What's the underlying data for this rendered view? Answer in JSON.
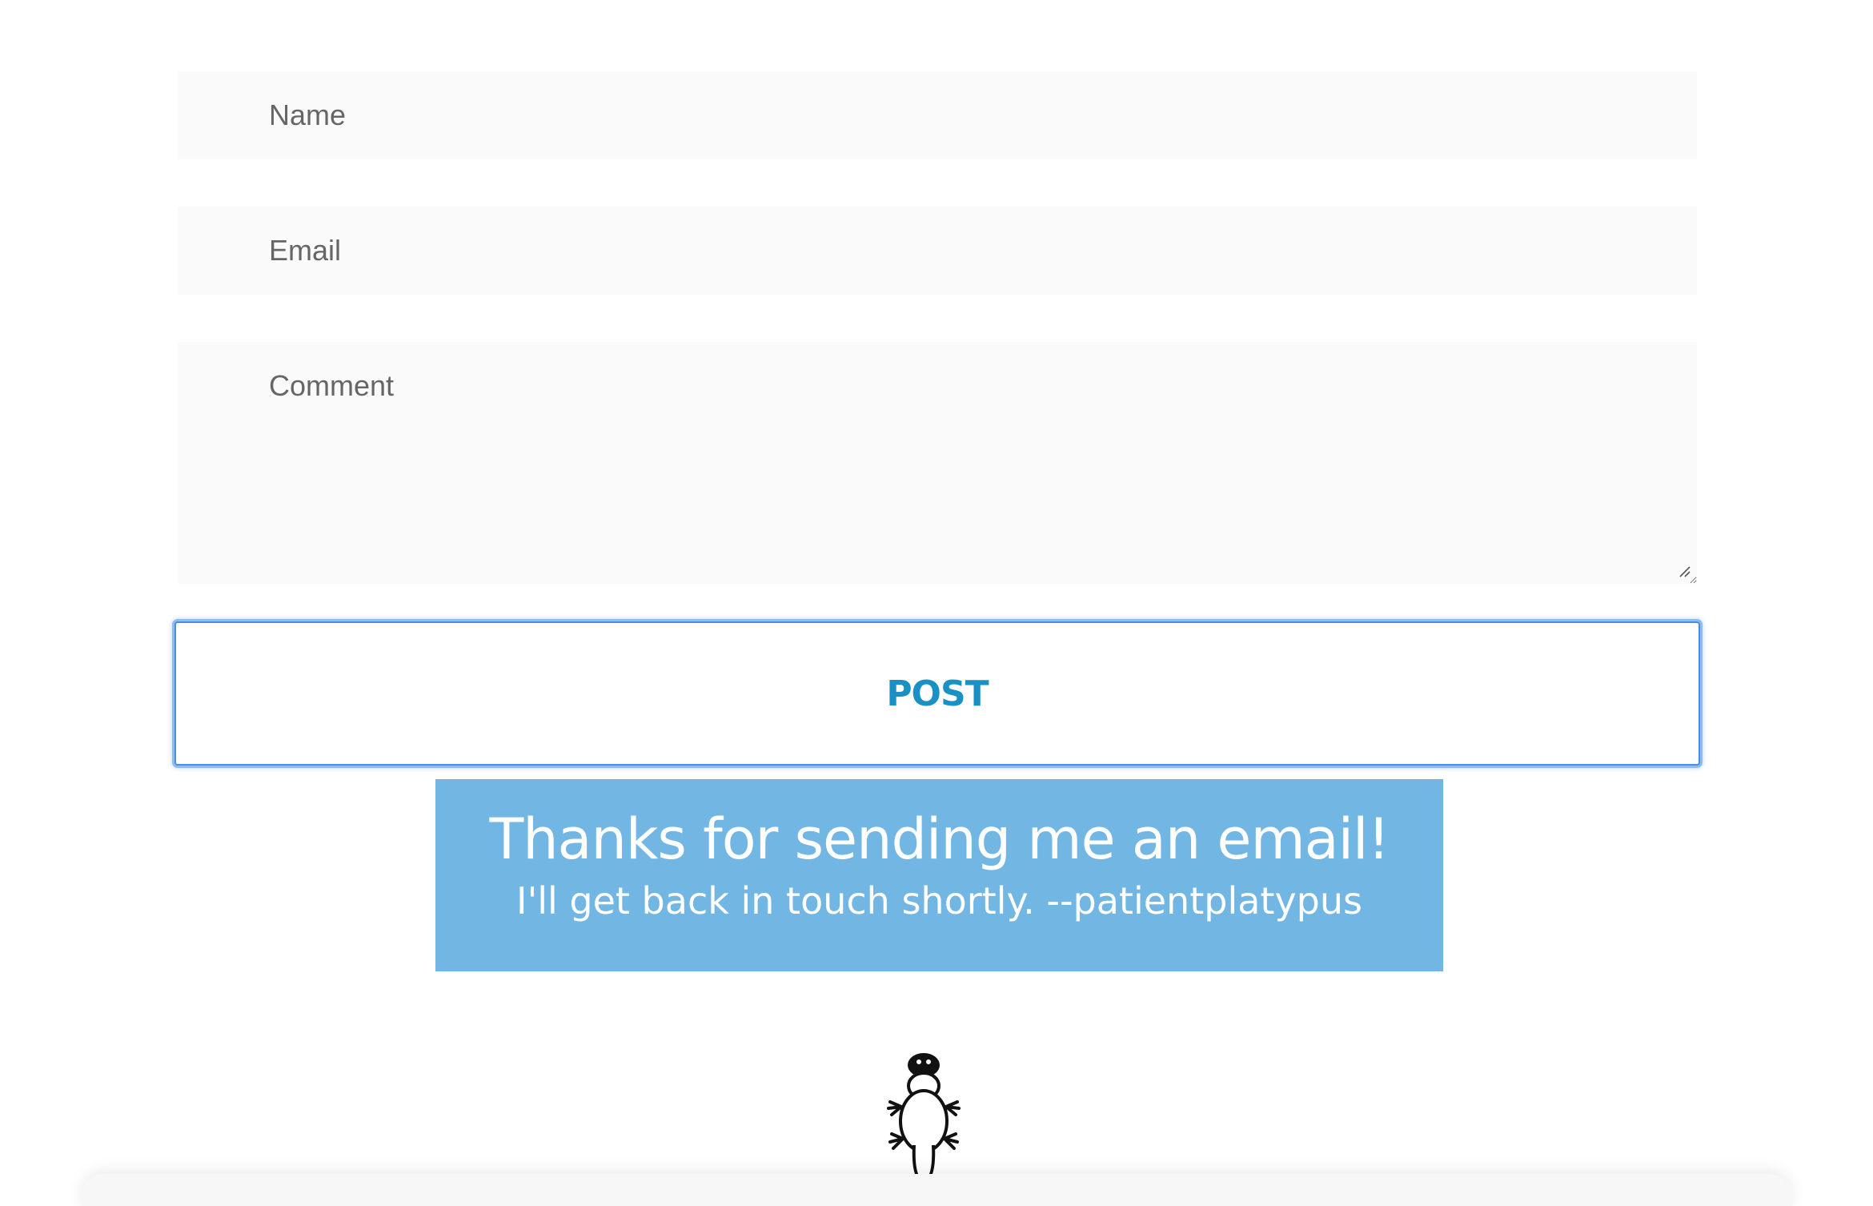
{
  "form": {
    "name_placeholder": "Name",
    "email_placeholder": "Email",
    "comment_placeholder": "Comment",
    "post_label": "POST"
  },
  "confirmation": {
    "title": "Thanks for sending me an email!",
    "subtitle": "I'll get back in touch shortly. --patientplatypus"
  },
  "icons": {
    "mascot": "platypus-icon",
    "grip": "resize-grip-icon"
  },
  "colors": {
    "accent": "#1a91c4",
    "banner": "#72b6e4",
    "focus_ring": "#4a90e2",
    "field_bg": "#fafafa"
  }
}
